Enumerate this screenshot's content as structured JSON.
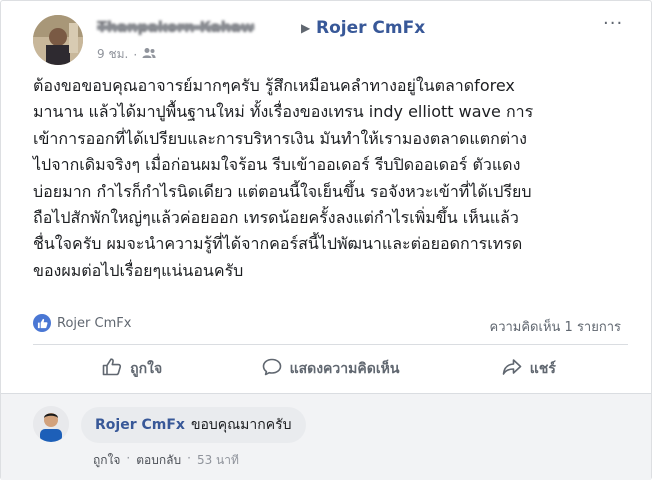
{
  "post": {
    "author": "Thanpakorn Kahaw",
    "arrow": "▶",
    "target": "Rojer CmFx",
    "time": "9 ชม.",
    "dot": "·",
    "more": "···",
    "text": "ต้องขอขอบคุณอาจารย์มากๆครับ รู้สึกเหมือนคลำทางอยู่ในตลาดforex\nมานาน แล้วได้มาปูพื้นฐานใหม่ ทั้งเรื่องของเทรน indy elliott wave การ\nเข้าการออกที่ได้เปรียบและการบริหารเงิน มันทำให้เรามองตลาดแตกต่าง\nไปจากเดิมจริงๆ เมื่อก่อนผมใจร้อน รีบเข้าออเดอร์ รีบปิดออเดอร์ ตัวแดง\nบ่อยมาก กำไรก็กำไรนิดเดียว แต่ตอนนี้ใจเย็นขึ้น รอจังหวะเข้าที่ได้เปรียบ\nถือไปสักพักใหญ่ๆแล้วค่อยออก เทรดน้อยครั้งลงแต่กำไรเพิ่มขึ้น เห็นแล้ว\nชื่นใจครับ ผมจะนำความรู้ที่ได้จากคอร์สนี้ไปพัฒนาและต่อยอดการเทรด\nของผมต่อไปเรื่อยๆแน่นอนครับ"
  },
  "reactions": {
    "liker": "Rojer CmFx",
    "comments_count": "ความคิดเห็น 1 รายการ"
  },
  "actions": {
    "like": "ถูกใจ",
    "comment": "แสดงความคิดเห็น",
    "share": "แชร์"
  },
  "comment": {
    "name": "Rojer CmFx",
    "text": "ขอบคุณมากครับ",
    "like": "ถูกใจ",
    "sep": "·",
    "reply": "ตอบกลับ",
    "time": "53 นาที"
  },
  "colors": {
    "link_blue": "#385898",
    "like_blue": "#4a77d4",
    "muted": "#606770",
    "divider": "#dadde1"
  }
}
